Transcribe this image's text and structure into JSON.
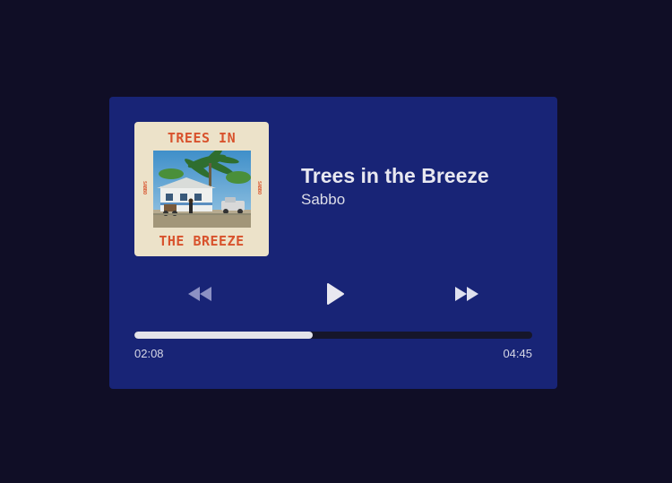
{
  "track": {
    "title": "Trees in the Breeze",
    "artist": "Sabbo"
  },
  "cover": {
    "title_top": "TREES IN",
    "title_bottom": "THE BREEZE",
    "side_text": "SABBO"
  },
  "controls": {
    "rewind_icon": "rewind-icon",
    "play_icon": "play-icon",
    "forward_icon": "fast-forward-icon"
  },
  "progress": {
    "current_time": "02:08",
    "total_time": "04:45",
    "fraction": 0.449
  },
  "colors": {
    "background": "#100e26",
    "player": "#182476",
    "progress_fill": "#e3e3ea",
    "progress_track": "#16162a",
    "cover_accent": "#d8522c"
  }
}
